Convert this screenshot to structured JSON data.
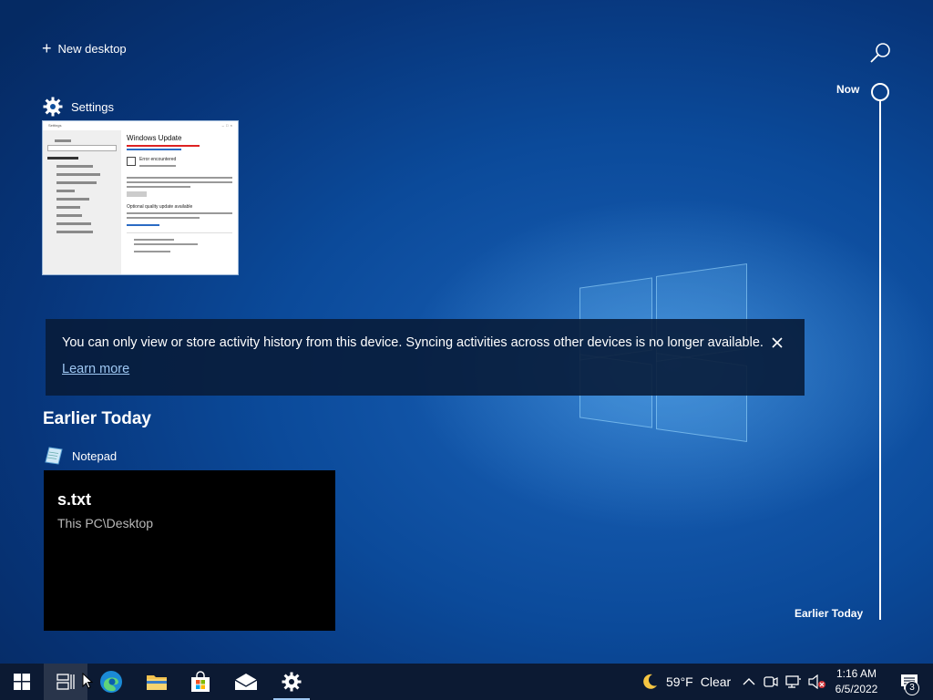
{
  "new_desktop": {
    "label": "New desktop"
  },
  "settings_activity": {
    "app_name": "Settings",
    "thumbnail": {
      "window_title": "Settings",
      "page_title": "Windows Update",
      "left_nav_heading": "Update & Security",
      "left_nav_items": [
        "Home",
        "Windows Update",
        "Delivery Optimization",
        "Windows Security",
        "Backup",
        "Troubleshoot",
        "Recovery",
        "Activation",
        "Find my device",
        "For developers"
      ],
      "status_title": "Error encountered",
      "optional_title": "Optional quality update available"
    }
  },
  "banner": {
    "message": "You can only view or store activity history from this device. Syncing activities across other devices is no longer available.",
    "link": "Learn more"
  },
  "section": {
    "title": "Earlier Today"
  },
  "notepad_activity": {
    "app_name": "Notepad",
    "file_name": "s.txt",
    "location": "This PC\\Desktop"
  },
  "timeline": {
    "top_label": "Now",
    "bottom_label": "Earlier Today"
  },
  "taskbar": {
    "weather_temp": "59°F",
    "weather_desc": "Clear",
    "time": "1:16 AM",
    "date": "6/5/2022",
    "notification_count": "3",
    "accent_color": "#9ec7f2",
    "background_color": "#0c1a33"
  }
}
